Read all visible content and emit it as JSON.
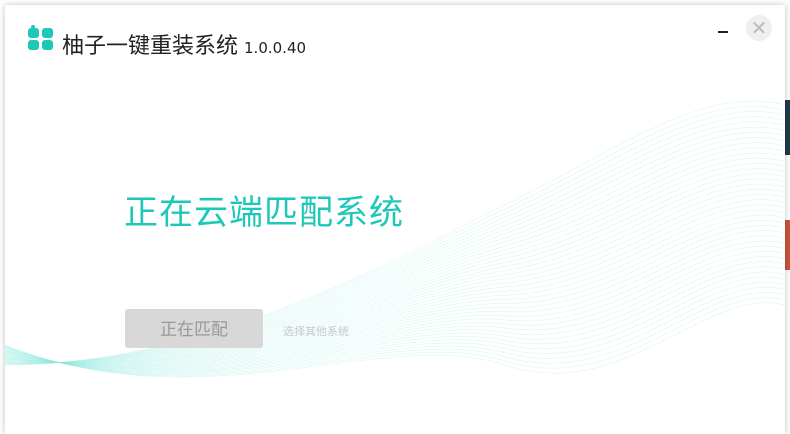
{
  "window": {
    "app_title": "柚子一键重装系统",
    "version": "1.0.0.40",
    "minimize_icon": "minimize-icon",
    "close_icon": "close-icon",
    "close_glyph": "✕"
  },
  "main": {
    "status_text": "正在云端匹配系统",
    "match_button_label": "正在匹配",
    "choose_other_link": "选择其他系统"
  },
  "colors": {
    "accent": "#1ec8b8",
    "button_bg": "#d8d8d8",
    "wave": "#8fe8e0"
  }
}
